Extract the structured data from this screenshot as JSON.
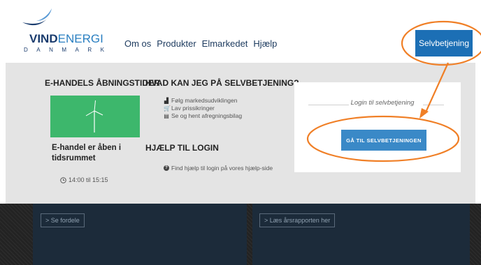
{
  "header": {
    "logo": {
      "brand_bold": "VIND",
      "brand_light": "ENERGI",
      "subtitle": "DANMARK"
    },
    "nav": [
      {
        "label": "Om os"
      },
      {
        "label": "Produkter"
      },
      {
        "label": "Elmarkedet"
      },
      {
        "label": "Hjælp"
      }
    ],
    "self_service_button": "Selvbetjening"
  },
  "opening_hours": {
    "title": "E-HANDELS ÅBNINGSTIDER",
    "status_text": "E-handel er åben i tidsrummet",
    "hours": "14:00 til 15:15",
    "icon": "clock-icon"
  },
  "self_service_info": {
    "title": "HVAD KAN JEG PÅ SELVBETJENING?",
    "features": [
      {
        "icon": "bar-chart-icon",
        "text": "Følg markedsudviklingen"
      },
      {
        "icon": "cart-icon",
        "text": "Lav prissikringer"
      },
      {
        "icon": "document-icon",
        "text": "Se og hent afregningsbilag"
      }
    ],
    "help_title": "HJÆLP TIL LOGIN",
    "help_link": "Find hjælp til login på vores hjælp-side"
  },
  "login": {
    "label": "Login til selvbetjening",
    "button": "GÅ TIL SELVBETJENINGEN"
  },
  "bottom": {
    "link_left": "> Se fordele",
    "link_right": "> Læs årsrapporten her"
  },
  "colors": {
    "primary_blue": "#1c6fb5",
    "login_button_blue": "#3a89c7",
    "green_tile": "#3db76c",
    "annotation_orange": "#f07f26",
    "panel_gray": "#e4e4e4",
    "dark_card": "#1c2b3a"
  }
}
